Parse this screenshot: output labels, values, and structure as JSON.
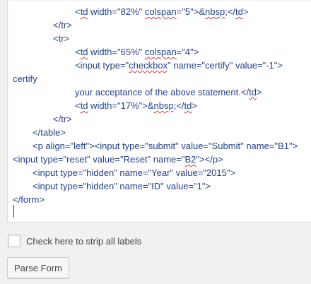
{
  "editor": {
    "lines": [
      {
        "indent": 88,
        "text": "<td width=\"82%\" colspan=\"5\">&nbsp;</td>"
      },
      {
        "indent": 57,
        "text": "</tr>"
      },
      {
        "indent": 57,
        "text": "<tr>"
      },
      {
        "indent": 88,
        "text": "<td width=\"65%\" colspan=\"4\">"
      },
      {
        "indent": 88,
        "text": "<input type=\"checkbox\" name=\"certify\" value=\"-1\">"
      },
      {
        "indent": 0,
        "text": "certify"
      },
      {
        "indent": 88,
        "text": "your acceptance of the above statement.</td>"
      },
      {
        "indent": 88,
        "text": "<td width=\"17%\">&nbsp;</td>"
      },
      {
        "indent": 57,
        "text": "</tr>"
      },
      {
        "indent": 28,
        "text": "</table>"
      },
      {
        "indent": 28,
        "text": "<p align=\"left\"><input type=\"submit\" value=\"Submit\" name=\"B1\">"
      },
      {
        "indent": 0,
        "text": "<input type=\"reset\" value=\"Reset\" name=\"B2\"></p>"
      },
      {
        "indent": 28,
        "text": "<input type=\"hidden\" name=\"Year\" value=\"2015\">"
      },
      {
        "indent": 28,
        "text": "<input type=\"hidden\" name=\"ID\" value=\"1\">"
      },
      {
        "indent": 0,
        "text": "</form>"
      }
    ]
  },
  "strip_labels": {
    "label": "Check here to strip all labels",
    "checked": false
  },
  "parse_button": {
    "label": "Parse Form"
  }
}
